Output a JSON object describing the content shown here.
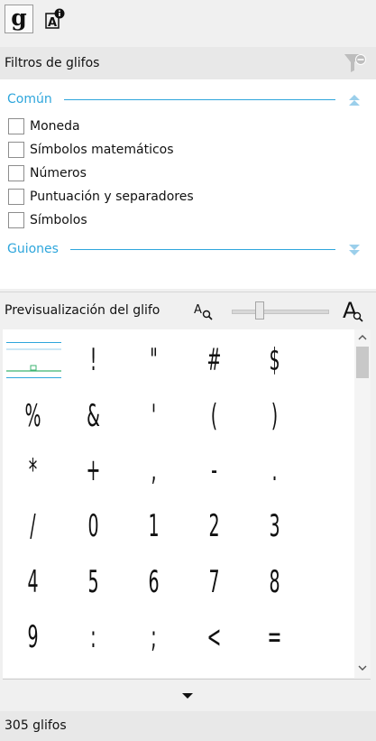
{
  "toolbar": {
    "glyph_button_label": "g",
    "info_button_icon": "font-info-icon"
  },
  "filters_header": {
    "title": "Filtros de glifos",
    "icon": "filter-remove-icon"
  },
  "groups": [
    {
      "title": "Común",
      "expanded": true,
      "items": [
        {
          "label": "Moneda",
          "checked": false
        },
        {
          "label": "Símbolos matemáticos",
          "checked": false
        },
        {
          "label": "Números",
          "checked": false
        },
        {
          "label": "Puntuación y separadores",
          "checked": false
        },
        {
          "label": "Símbolos",
          "checked": false
        }
      ]
    },
    {
      "title": "Guiones",
      "expanded": false,
      "items": []
    }
  ],
  "preview": {
    "title": "Previsualización del glifo",
    "zoom_small_icon": "zoom-out-icon",
    "zoom_large_icon": "zoom-in-icon",
    "zoom_level": 0.27
  },
  "glyphs": [
    " ",
    "!",
    "\"",
    "#",
    "$",
    "%",
    "&",
    "'",
    "(",
    ")",
    "*",
    "+",
    ",",
    "-",
    ".",
    "/",
    "0",
    "1",
    "2",
    "3",
    "4",
    "5",
    "6",
    "7",
    "8",
    "9",
    ":",
    ";",
    "<",
    "="
  ],
  "status": {
    "count_text": "305 glifos"
  },
  "colors": {
    "accent": "#2ea6dc",
    "selection_green": "#3cb371"
  }
}
